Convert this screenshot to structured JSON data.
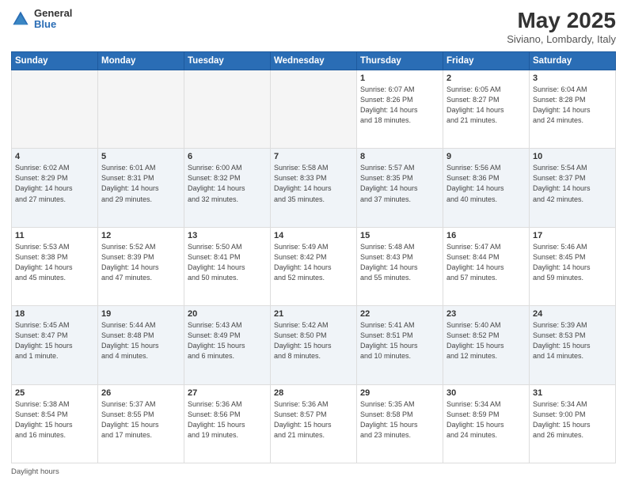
{
  "header": {
    "logo_general": "General",
    "logo_blue": "Blue",
    "month_year": "May 2025",
    "location": "Siviano, Lombardy, Italy"
  },
  "footer": {
    "label": "Daylight hours"
  },
  "weekdays": [
    "Sunday",
    "Monday",
    "Tuesday",
    "Wednesday",
    "Thursday",
    "Friday",
    "Saturday"
  ],
  "weeks": [
    [
      {
        "day": "",
        "info": ""
      },
      {
        "day": "",
        "info": ""
      },
      {
        "day": "",
        "info": ""
      },
      {
        "day": "",
        "info": ""
      },
      {
        "day": "1",
        "info": "Sunrise: 6:07 AM\nSunset: 8:26 PM\nDaylight: 14 hours\nand 18 minutes."
      },
      {
        "day": "2",
        "info": "Sunrise: 6:05 AM\nSunset: 8:27 PM\nDaylight: 14 hours\nand 21 minutes."
      },
      {
        "day": "3",
        "info": "Sunrise: 6:04 AM\nSunset: 8:28 PM\nDaylight: 14 hours\nand 24 minutes."
      }
    ],
    [
      {
        "day": "4",
        "info": "Sunrise: 6:02 AM\nSunset: 8:29 PM\nDaylight: 14 hours\nand 27 minutes."
      },
      {
        "day": "5",
        "info": "Sunrise: 6:01 AM\nSunset: 8:31 PM\nDaylight: 14 hours\nand 29 minutes."
      },
      {
        "day": "6",
        "info": "Sunrise: 6:00 AM\nSunset: 8:32 PM\nDaylight: 14 hours\nand 32 minutes."
      },
      {
        "day": "7",
        "info": "Sunrise: 5:58 AM\nSunset: 8:33 PM\nDaylight: 14 hours\nand 35 minutes."
      },
      {
        "day": "8",
        "info": "Sunrise: 5:57 AM\nSunset: 8:35 PM\nDaylight: 14 hours\nand 37 minutes."
      },
      {
        "day": "9",
        "info": "Sunrise: 5:56 AM\nSunset: 8:36 PM\nDaylight: 14 hours\nand 40 minutes."
      },
      {
        "day": "10",
        "info": "Sunrise: 5:54 AM\nSunset: 8:37 PM\nDaylight: 14 hours\nand 42 minutes."
      }
    ],
    [
      {
        "day": "11",
        "info": "Sunrise: 5:53 AM\nSunset: 8:38 PM\nDaylight: 14 hours\nand 45 minutes."
      },
      {
        "day": "12",
        "info": "Sunrise: 5:52 AM\nSunset: 8:39 PM\nDaylight: 14 hours\nand 47 minutes."
      },
      {
        "day": "13",
        "info": "Sunrise: 5:50 AM\nSunset: 8:41 PM\nDaylight: 14 hours\nand 50 minutes."
      },
      {
        "day": "14",
        "info": "Sunrise: 5:49 AM\nSunset: 8:42 PM\nDaylight: 14 hours\nand 52 minutes."
      },
      {
        "day": "15",
        "info": "Sunrise: 5:48 AM\nSunset: 8:43 PM\nDaylight: 14 hours\nand 55 minutes."
      },
      {
        "day": "16",
        "info": "Sunrise: 5:47 AM\nSunset: 8:44 PM\nDaylight: 14 hours\nand 57 minutes."
      },
      {
        "day": "17",
        "info": "Sunrise: 5:46 AM\nSunset: 8:45 PM\nDaylight: 14 hours\nand 59 minutes."
      }
    ],
    [
      {
        "day": "18",
        "info": "Sunrise: 5:45 AM\nSunset: 8:47 PM\nDaylight: 15 hours\nand 1 minute."
      },
      {
        "day": "19",
        "info": "Sunrise: 5:44 AM\nSunset: 8:48 PM\nDaylight: 15 hours\nand 4 minutes."
      },
      {
        "day": "20",
        "info": "Sunrise: 5:43 AM\nSunset: 8:49 PM\nDaylight: 15 hours\nand 6 minutes."
      },
      {
        "day": "21",
        "info": "Sunrise: 5:42 AM\nSunset: 8:50 PM\nDaylight: 15 hours\nand 8 minutes."
      },
      {
        "day": "22",
        "info": "Sunrise: 5:41 AM\nSunset: 8:51 PM\nDaylight: 15 hours\nand 10 minutes."
      },
      {
        "day": "23",
        "info": "Sunrise: 5:40 AM\nSunset: 8:52 PM\nDaylight: 15 hours\nand 12 minutes."
      },
      {
        "day": "24",
        "info": "Sunrise: 5:39 AM\nSunset: 8:53 PM\nDaylight: 15 hours\nand 14 minutes."
      }
    ],
    [
      {
        "day": "25",
        "info": "Sunrise: 5:38 AM\nSunset: 8:54 PM\nDaylight: 15 hours\nand 16 minutes."
      },
      {
        "day": "26",
        "info": "Sunrise: 5:37 AM\nSunset: 8:55 PM\nDaylight: 15 hours\nand 17 minutes."
      },
      {
        "day": "27",
        "info": "Sunrise: 5:36 AM\nSunset: 8:56 PM\nDaylight: 15 hours\nand 19 minutes."
      },
      {
        "day": "28",
        "info": "Sunrise: 5:36 AM\nSunset: 8:57 PM\nDaylight: 15 hours\nand 21 minutes."
      },
      {
        "day": "29",
        "info": "Sunrise: 5:35 AM\nSunset: 8:58 PM\nDaylight: 15 hours\nand 23 minutes."
      },
      {
        "day": "30",
        "info": "Sunrise: 5:34 AM\nSunset: 8:59 PM\nDaylight: 15 hours\nand 24 minutes."
      },
      {
        "day": "31",
        "info": "Sunrise: 5:34 AM\nSunset: 9:00 PM\nDaylight: 15 hours\nand 26 minutes."
      }
    ]
  ]
}
